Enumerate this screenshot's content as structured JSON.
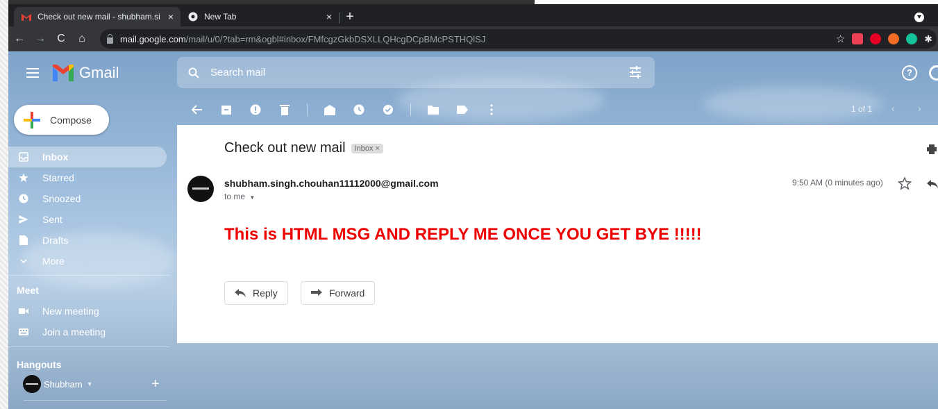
{
  "browser": {
    "tabs": [
      {
        "title": "Check out new mail - shubham.si",
        "close": "×"
      },
      {
        "title": "New Tab",
        "close": "×"
      }
    ],
    "new_tab": "+",
    "url_host": "mail.google.com",
    "url_path": "/mail/u/0/?tab=rm&ogbl#inbox/FMfcgzGkbDSXLLQHcgDCpBMcPSTHQlSJ"
  },
  "gmail": {
    "logo_text": "Gmail",
    "search_placeholder": "Search mail",
    "compose_label": "Compose",
    "nav": [
      {
        "label": "Inbox",
        "icon": "inbox-icon"
      },
      {
        "label": "Starred",
        "icon": "star-icon"
      },
      {
        "label": "Snoozed",
        "icon": "clock-icon"
      },
      {
        "label": "Sent",
        "icon": "send-icon"
      },
      {
        "label": "Drafts",
        "icon": "draft-icon"
      },
      {
        "label": "More",
        "icon": "chevron-down-icon"
      }
    ],
    "meet": {
      "title": "Meet",
      "items": [
        {
          "label": "New meeting",
          "icon": "video-icon"
        },
        {
          "label": "Join a meeting",
          "icon": "keyboard-icon"
        }
      ]
    },
    "hangouts": {
      "title": "Hangouts",
      "user": "Shubham"
    },
    "paging": "1 of 1",
    "help_symbol": "?"
  },
  "email": {
    "subject": "Check out new mail",
    "label_chip": "Inbox ×",
    "sender": "shubham.singh.chouhan11112000@gmail.com",
    "to": "to me",
    "time": "9:50 AM (0 minutes ago)",
    "body": "This is HTML MSG AND REPLY ME ONCE YOU GET BYE !!!!!",
    "reply_label": "Reply",
    "forward_label": "Forward"
  },
  "colors": {
    "body_text": "#ee0000",
    "chrome_dark": "#202124",
    "chrome_toolbar": "#35363a"
  }
}
